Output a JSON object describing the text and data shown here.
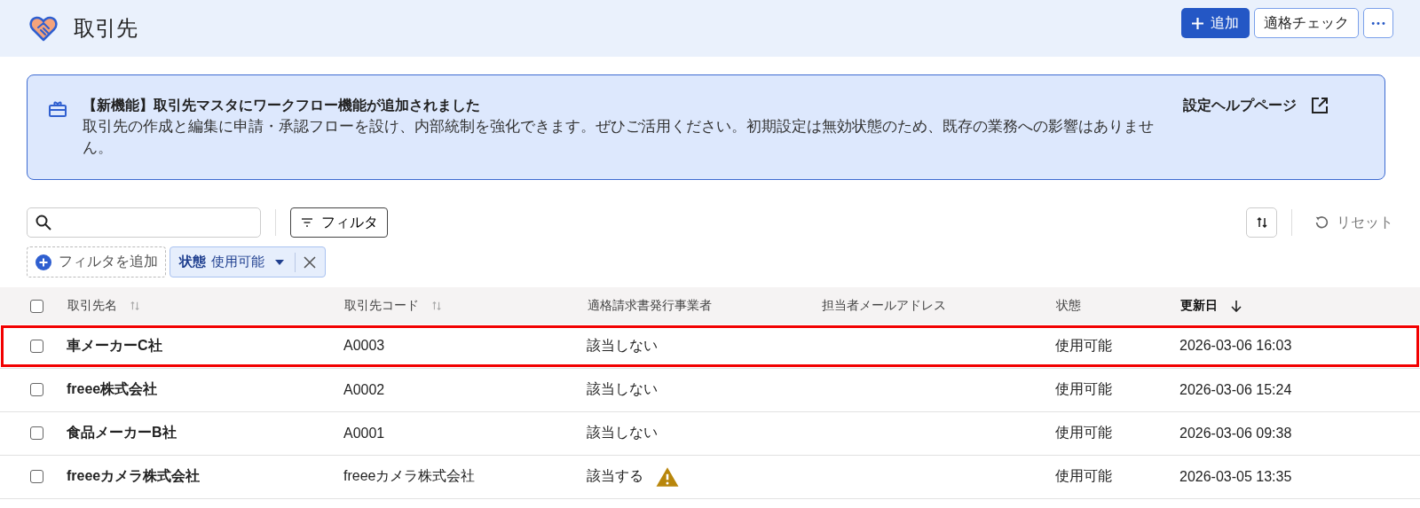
{
  "header": {
    "title": "取引先",
    "buttons": [
      {
        "kind": "add",
        "label": "追加"
      },
      {
        "kind": "outline",
        "label": "適格チェック"
      },
      {
        "kind": "more",
        "label": "•••"
      }
    ]
  },
  "banner": {
    "title": "【新機能】取引先マスタにワークフロー機能が追加されました",
    "body": "取引先の作成と編集に申請・承認フローを設け、内部統制を強化できます。ぜひご活用ください。初期設定は無効状態のため、既存の業務への影響はありません。",
    "link": "設定ヘルプページ"
  },
  "toolbar": {
    "filter_button": "フィルタ",
    "reset": "リセット"
  },
  "filters": {
    "add": "フィルタを追加",
    "chips": [
      {
        "key": "状態",
        "value": "使用可能"
      }
    ]
  },
  "table": {
    "all_checked": false,
    "columns": [
      {
        "label": "取引先名",
        "kind": "sortable"
      },
      {
        "label": "取引先コード",
        "kind": "sortable"
      },
      {
        "label": "適格請求書発行事業者",
        "kind": "plain"
      },
      {
        "label": "担当者メールアドレス",
        "kind": "plain"
      },
      {
        "label": "状態",
        "kind": "plain"
      },
      {
        "label": "更新日",
        "kind": "sorted"
      }
    ],
    "rows": [
      {
        "checked": false,
        "highlighted": true,
        "name": "車メーカーC社",
        "code": "A0003",
        "qualified": "該当しない",
        "warning": false,
        "status": "使用可能",
        "updated": "2026-03-06 16:03"
      },
      {
        "checked": false,
        "highlighted": false,
        "name": "freee株式会社",
        "code": "A0002",
        "qualified": "該当しない",
        "warning": false,
        "status": "使用可能",
        "updated": "2026-03-06 15:24"
      },
      {
        "checked": false,
        "highlighted": false,
        "name": "食品メーカーB社",
        "code": "A0001",
        "qualified": "該当しない",
        "warning": false,
        "status": "使用可能",
        "updated": "2026-03-06 09:38"
      },
      {
        "checked": false,
        "highlighted": false,
        "name": "freeeカメラ株式会社",
        "code": "freeeカメラ株式会社",
        "qualified": "該当する",
        "warning": true,
        "status": "使用可能",
        "updated": "2026-03-05 13:35"
      }
    ]
  }
}
